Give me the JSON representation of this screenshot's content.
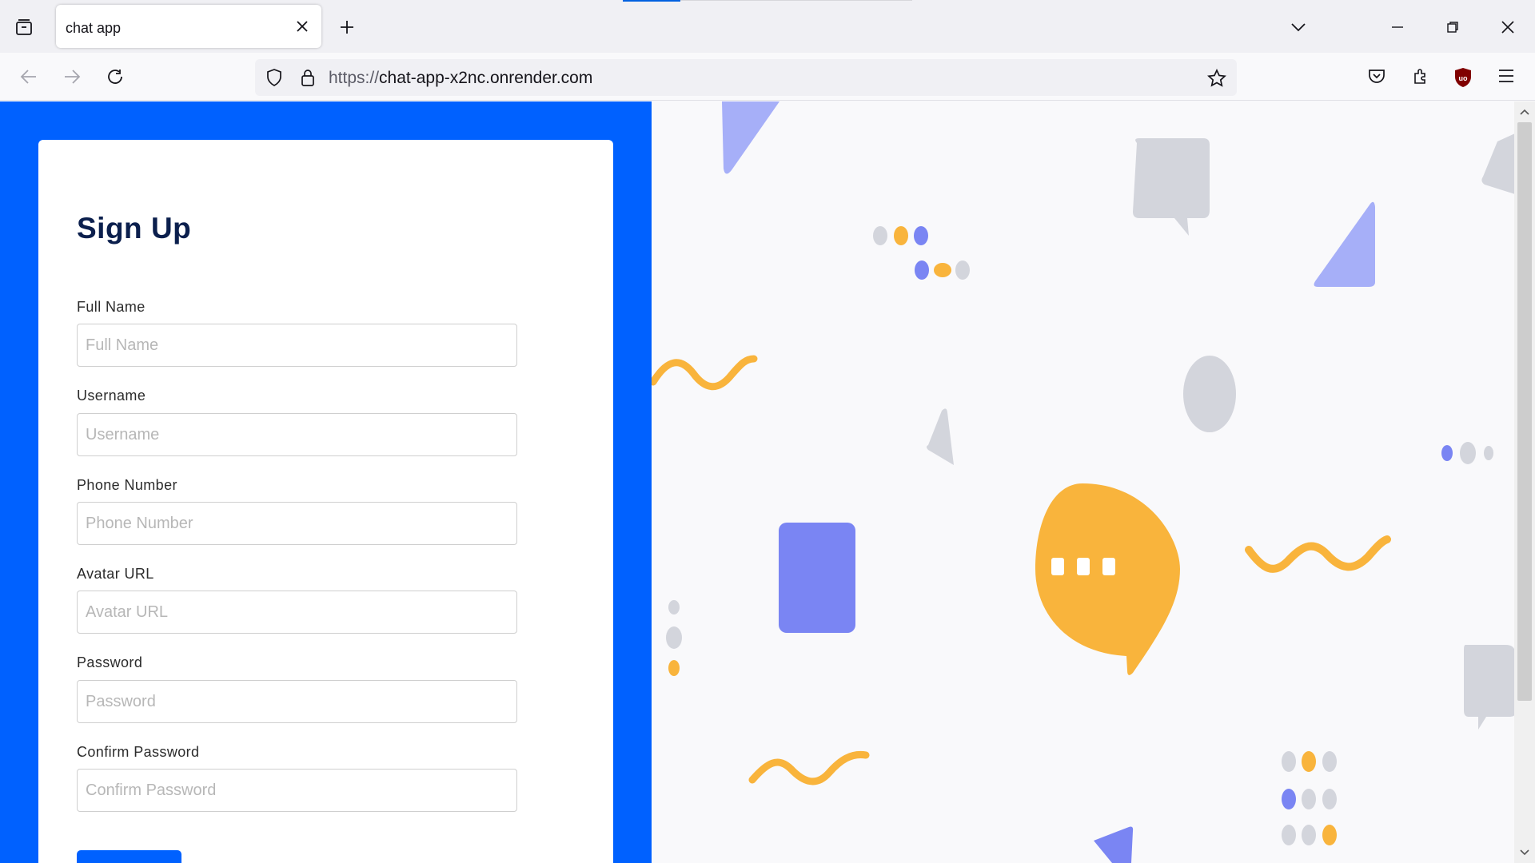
{
  "browser": {
    "tab_title": "chat app",
    "url_scheme": "https://",
    "url_host": "chat-app-x2nc.onrender.com",
    "icons": [
      "tab-list-icon",
      "close-icon",
      "plus-icon",
      "chevron-down-icon",
      "minimize-icon",
      "restore-icon",
      "close-window-icon",
      "back-icon",
      "forward-icon",
      "reload-icon",
      "shield-icon",
      "lock-icon",
      "star-icon",
      "pocket-icon",
      "extensions-icon",
      "ublock-icon",
      "menu-icon"
    ]
  },
  "form": {
    "title": "Sign Up",
    "fields": [
      {
        "label": "Full Name",
        "placeholder": "Full Name"
      },
      {
        "label": "Username",
        "placeholder": "Username"
      },
      {
        "label": "Phone Number",
        "placeholder": "Phone Number"
      },
      {
        "label": "Avatar URL",
        "placeholder": "Avatar URL"
      },
      {
        "label": "Password",
        "placeholder": "Password"
      },
      {
        "label": "Confirm Password",
        "placeholder": "Confirm Password"
      }
    ]
  },
  "colors": {
    "accent": "#0061ff",
    "heading": "#0b1f4d",
    "illustration_yellow": "#f9b43c",
    "illustration_purple": "#7a85f3",
    "illustration_light_purple": "#a6aff8",
    "illustration_gray": "#d3d5dc"
  }
}
